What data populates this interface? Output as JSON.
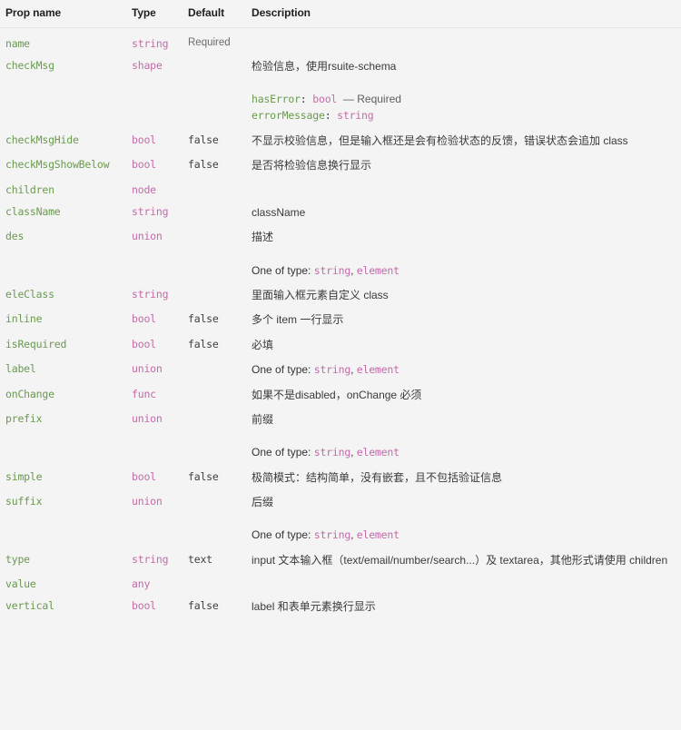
{
  "table": {
    "headers": {
      "prop_name": "Prop name",
      "type": "Type",
      "default": "Default",
      "description": "Description"
    },
    "colors": {
      "prop_name": "#6a9a4f",
      "type": "#c26ba8",
      "default": "#3f3f3f",
      "description": "#3a3a3a",
      "background": "#f4f4f4",
      "header_rule": "#e6e6e6"
    },
    "oneof_label": "One of type:",
    "oneof_separator": ",",
    "rows": [
      {
        "prop": "name",
        "type": "string",
        "default": "Required",
        "default_style": "sans",
        "desc": ""
      },
      {
        "prop": "checkMsg",
        "type": "shape",
        "default": "",
        "desc": "检验信息，使用rsuite-schema",
        "shape_fields": [
          {
            "key": "hasError",
            "type": "bool",
            "required": "— Required"
          },
          {
            "key": "errorMessage",
            "type": "string",
            "required": ""
          }
        ]
      },
      {
        "prop": "checkMsgHide",
        "type": "bool",
        "default": "false",
        "default_style": "mono",
        "desc": "不显示校验信息，但是输入框还是会有检验状态的反馈，错误状态会追加 class"
      },
      {
        "prop": "checkMsgShowBelow",
        "type": "bool",
        "default": "false",
        "default_style": "mono",
        "desc": "是否将检验信息换行显示"
      },
      {
        "prop": "children",
        "type": "node",
        "default": "",
        "desc": ""
      },
      {
        "prop": "className",
        "type": "string",
        "default": "",
        "desc": "className"
      },
      {
        "prop": "des",
        "type": "union",
        "default": "",
        "desc": "描述",
        "oneof": [
          "string",
          "element"
        ]
      },
      {
        "prop": "eleClass",
        "type": "string",
        "default": "",
        "desc": "里面输入框元素自定义 class"
      },
      {
        "prop": "inline",
        "type": "bool",
        "default": "false",
        "default_style": "mono",
        "desc": "多个 item 一行显示"
      },
      {
        "prop": "isRequired",
        "type": "bool",
        "default": "false",
        "default_style": "mono",
        "desc": "必填"
      },
      {
        "prop": "label",
        "type": "union",
        "default": "",
        "desc": "",
        "oneof": [
          "string",
          "element"
        ],
        "oneof_tight": true
      },
      {
        "prop": "onChange",
        "type": "func",
        "default": "",
        "desc": "如果不是disabled，onChange 必须"
      },
      {
        "prop": "prefix",
        "type": "union",
        "default": "",
        "desc": "前缀",
        "oneof": [
          "string",
          "element"
        ]
      },
      {
        "prop": "simple",
        "type": "bool",
        "default": "false",
        "default_style": "mono",
        "desc": "极简模式：结构简单，没有嵌套，且不包括验证信息"
      },
      {
        "prop": "suffix",
        "type": "union",
        "default": "",
        "desc": "后缀",
        "oneof": [
          "string",
          "element"
        ]
      },
      {
        "prop": "type",
        "type": "string",
        "default": "text",
        "default_style": "mono",
        "desc": "input 文本输入框（text/email/number/search...）及 textarea，其他形式请使用 children"
      },
      {
        "prop": "value",
        "type": "any",
        "default": "",
        "desc": ""
      },
      {
        "prop": "vertical",
        "type": "bool",
        "default": "false",
        "default_style": "mono",
        "desc": "label 和表单元素换行显示"
      }
    ]
  }
}
